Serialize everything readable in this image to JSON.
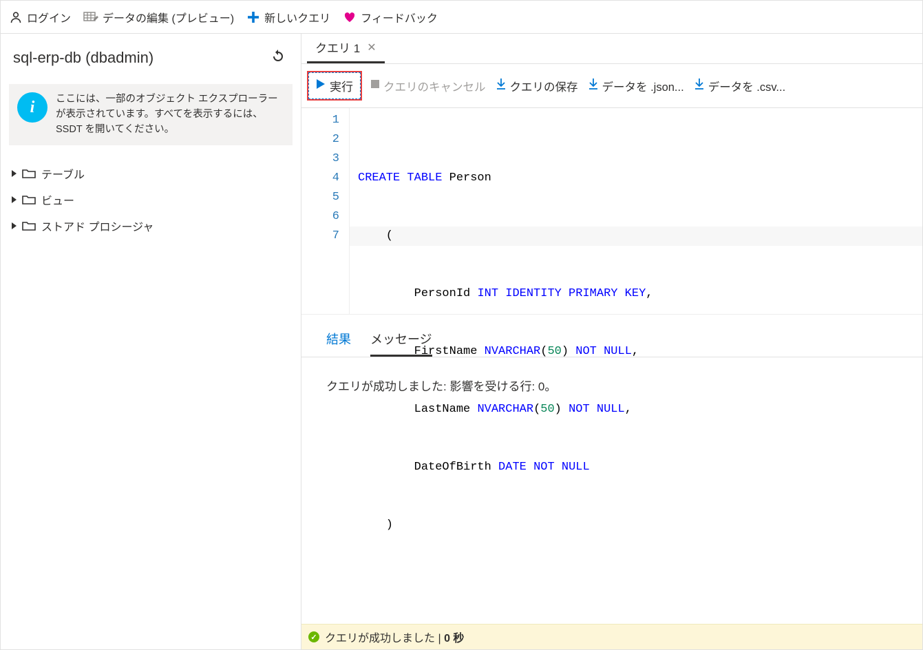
{
  "toolbar": {
    "login": "ログイン",
    "editData": "データの編集 (プレビュー)",
    "newQuery": "新しいクエリ",
    "feedback": "フィードバック"
  },
  "sidebar": {
    "dbTitle": "sql-erp-db (dbadmin)",
    "infoText": "ここには、一部のオブジェクト エクスプローラーが表示されています。すべてを表示するには、SSDT を開いてください。",
    "tree": {
      "tables": "テーブル",
      "views": "ビュー",
      "sprocs": "ストアド プロシージャ"
    }
  },
  "tabs": {
    "query1": "クエリ 1"
  },
  "queryToolbar": {
    "run": "実行",
    "cancel": "クエリのキャンセル",
    "save": "クエリの保存",
    "exportJson": "データを .json...",
    "exportCsv": "データを .csv..."
  },
  "editor": {
    "lines": [
      "1",
      "2",
      "3",
      "4",
      "5",
      "6",
      "7"
    ],
    "code": {
      "l1_kw": "CREATE TABLE",
      "l1_ident": " Person",
      "l2": "    (",
      "l3_ident": "        PersonId ",
      "l3_kw": "INT IDENTITY PRIMARY KEY",
      "l3_tail": ",",
      "l4_ident": "        FirstName ",
      "l4_kw1": "NVARCHAR",
      "l4_paren": "(",
      "l4_num": "50",
      "l4_paren2": ") ",
      "l4_kw2": "NOT NULL",
      "l4_tail": ",",
      "l5_ident": "        LastName ",
      "l5_kw1": "NVARCHAR",
      "l5_paren": "(",
      "l5_num": "50",
      "l5_paren2": ") ",
      "l5_kw2": "NOT NULL",
      "l5_tail": ",",
      "l6_ident": "        DateOfBirth ",
      "l6_kw1": "DATE",
      "l6_sp": " ",
      "l6_kw2": "NOT NULL",
      "l7": "    )"
    }
  },
  "results": {
    "tabResults": "結果",
    "tabMessages": "メッセージ",
    "message": "クエリが成功しました: 影響を受ける行: 0。"
  },
  "status": {
    "text": "クエリが成功しました ",
    "sep": "| ",
    "time": "0 秒"
  }
}
